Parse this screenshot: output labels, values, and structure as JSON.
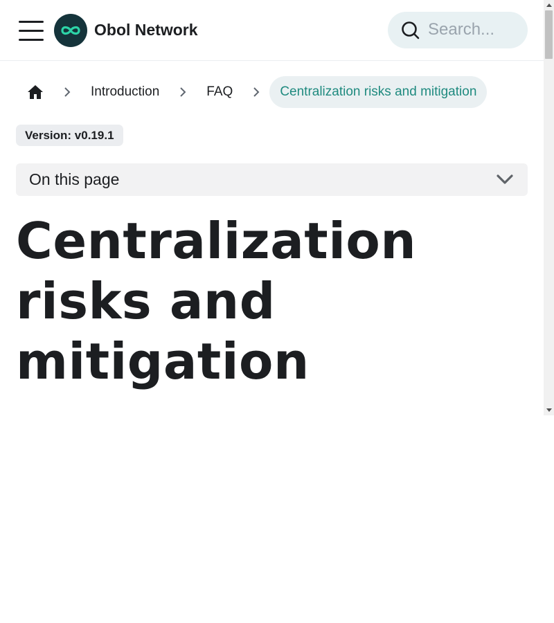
{
  "navbar": {
    "brand": "Obol Network",
    "search_placeholder": "Search...",
    "menu_icon": "hamburger-icon",
    "logo_icon": "infinity-logo",
    "logo_bg": "#15343b",
    "logo_accent": "#2dd4a8"
  },
  "breadcrumbs": {
    "home_icon": "home-icon",
    "items": [
      {
        "label": "Introduction"
      },
      {
        "label": "FAQ"
      },
      {
        "label": "Centralization risks and mitigation",
        "active": true
      }
    ],
    "active_color": "#1f8a7f"
  },
  "version": "Version: v0.19.1",
  "toc": {
    "label": "On this page",
    "icon": "chevron-down-icon"
  },
  "page_title": "Centralization risks and mitigation"
}
